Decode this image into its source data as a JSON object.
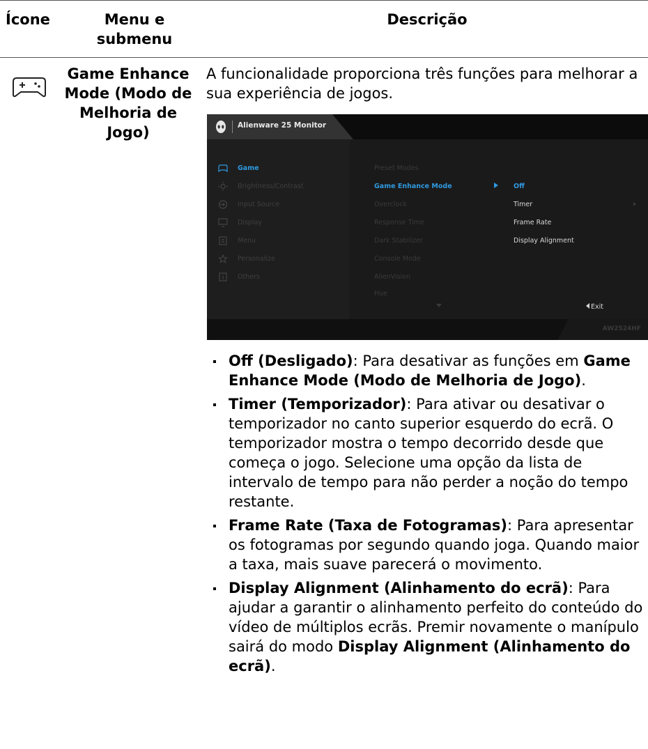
{
  "table": {
    "headers": {
      "icon": "Ícone",
      "menu": "Menu e submenu",
      "description": "Descrição"
    },
    "row": {
      "icon": "gamepad-icon",
      "menu_name": "Game Enhance Mode (Modo de Melhoria de Jogo)",
      "intro": "A funcionalidade proporciona três funções para melhorar a sua experiência de jogos."
    }
  },
  "osd": {
    "title": "Alienware 25 Monitor",
    "model": "AW2524HF",
    "accent": "#2f9ae0",
    "nav_items": [
      {
        "label": "Game",
        "icon": "gamepad-icon",
        "active": true
      },
      {
        "label": "Brightness/Contrast",
        "icon": "sun-icon"
      },
      {
        "label": "Input Source",
        "icon": "input-icon"
      },
      {
        "label": "Display",
        "icon": "monitor-icon"
      },
      {
        "label": "Menu",
        "icon": "menu-icon"
      },
      {
        "label": "Personalize",
        "icon": "star-icon"
      },
      {
        "label": "Others",
        "icon": "info-icon"
      }
    ],
    "submenu_items": [
      "Preset Modes",
      "Game Enhance Mode",
      "Overclock",
      "Response Time",
      "Dark Stabilizer",
      "Console Mode",
      "AlienVision",
      "Hue"
    ],
    "options": [
      "Off",
      "Timer",
      "Frame Rate",
      "Display Alignment"
    ],
    "exit_label": "Exit"
  },
  "bullets": [
    {
      "term": "Off (Desligado)",
      "text": ": Para desativar as funções em ",
      "term2": "Game Enhance Mode (Modo de Melhoria de Jogo)",
      "text2": "."
    },
    {
      "term": "Timer (Temporizador)",
      "text": ": Para ativar ou desativar o temporizador no canto superior esquerdo do ecrã. O temporizador mostra o tempo decorrido desde que começa o jogo. Selecione uma opção da lista de intervalo de tempo para não perder a noção do tempo restante.",
      "term2": "",
      "text2": ""
    },
    {
      "term": "Frame Rate (Taxa de Fotogramas)",
      "text": ": Para apresentar os fotogramas por segundo quando joga. Quando maior a taxa, mais suave parecerá o movimento.",
      "term2": "",
      "text2": ""
    },
    {
      "term": "Display Alignment (Alinhamento do ecrã)",
      "text": ": Para ajudar a garantir o alinhamento perfeito do conteúdo do vídeo de múltiplos ecrãs. Premir novamente o manípulo sairá do modo ",
      "term2": "Display Alignment (Alinhamento do ecrã)",
      "text2": "."
    }
  ]
}
